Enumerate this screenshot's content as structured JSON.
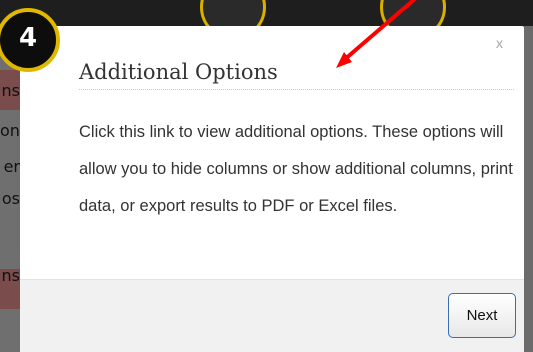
{
  "background": {
    "sidebar_fragments": [
      "ns",
      "ont",
      "er",
      "os",
      "ns"
    ]
  },
  "tooltip": {
    "step_number": "4",
    "title": "Additional Options",
    "close_label": "x",
    "description": "Click this link to view additional options. These options will allow you to hide columns or show additional columns, print data, or export results to PDF or Excel files.",
    "next_label": "Next"
  },
  "colors": {
    "badge_ring": "#e0b800",
    "arrow": "#ff0000",
    "next_border": "#3c6bb0"
  }
}
